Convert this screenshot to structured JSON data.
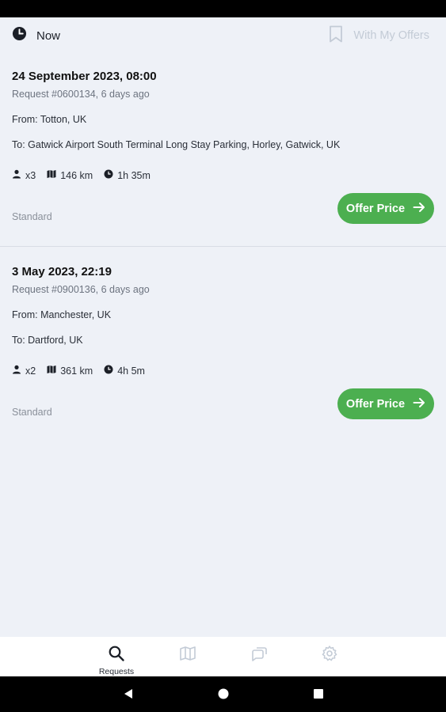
{
  "filter": {
    "time_label": "Now",
    "offers_label": "With My Offers"
  },
  "requests": [
    {
      "date": "24 September 2023, 08:00",
      "request_info": "Request #0600134, 6 days ago",
      "from": "From: Totton, UK",
      "to": "To: Gatwick Airport South Terminal Long Stay Parking, Horley, Gatwick, UK",
      "passengers": "x3",
      "distance": "146 km",
      "duration": "1h 35m",
      "category": "Standard",
      "offer_label": "Offer Price"
    },
    {
      "date": "3 May 2023, 22:19",
      "request_info": "Request #0900136, 6 days ago",
      "from": "From: Manchester, UK",
      "to": "To: Dartford, UK",
      "passengers": "x2",
      "distance": "361 km",
      "duration": "4h 5m",
      "category": "Standard",
      "offer_label": "Offer Price"
    }
  ],
  "bottom_nav": {
    "requests_label": "Requests"
  },
  "colors": {
    "accent_green": "#4caf50",
    "background": "#eef1f7",
    "muted": "#c3cbd6"
  },
  "icons": {
    "time": "clock-icon",
    "offers": "bookmark-icon",
    "passengers": "person-icon",
    "distance": "map-icon",
    "duration": "clock-icon",
    "offer": "arrow-right-icon",
    "nav": [
      "search-icon",
      "map-icon",
      "chat-icon",
      "gear-icon"
    ],
    "system": [
      "back-icon",
      "home-icon",
      "recents-icon"
    ]
  }
}
